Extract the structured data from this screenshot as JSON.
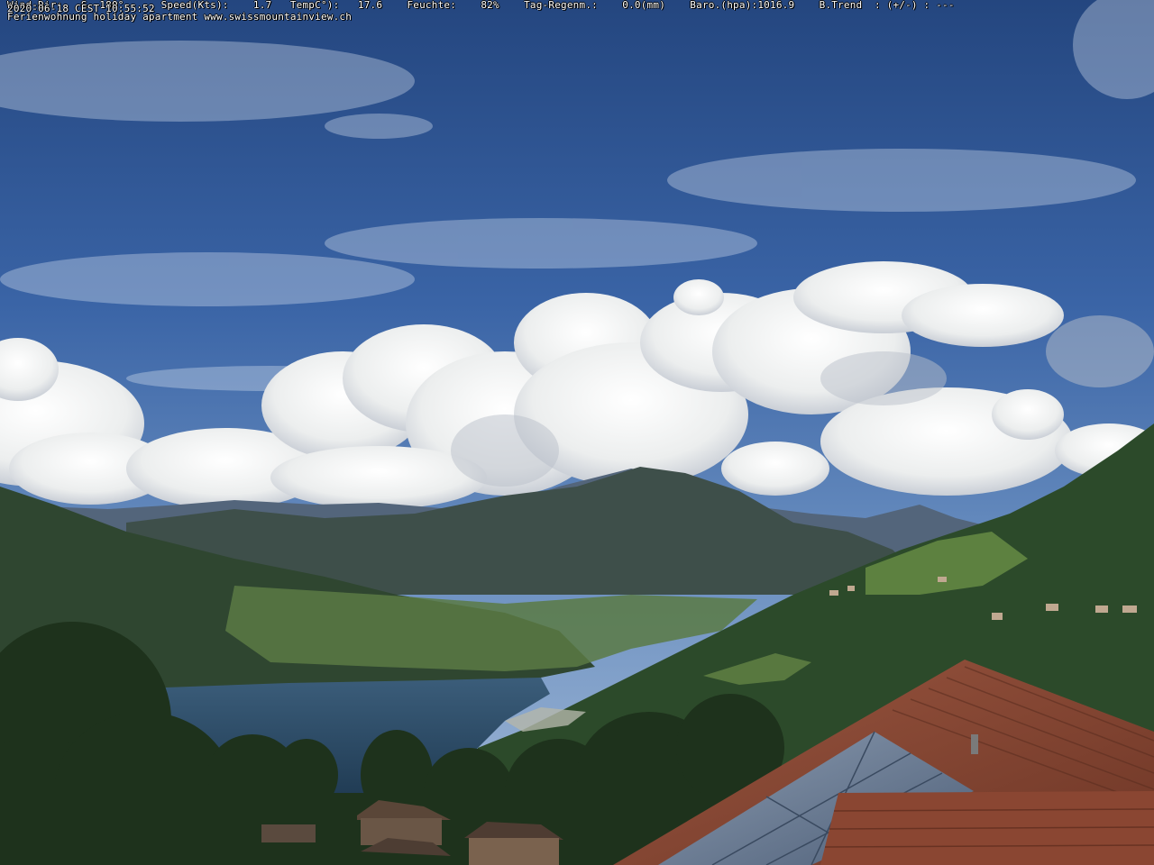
{
  "overlay": {
    "line1": "Wind-Dir:   S  180°      Speed(Kts):    1.7   TempC°):   17.6    Feuchte:    82%    Tag-Regenm.:    0.0(mm)    Baro.(hpa):1016.9    B.Trend  : (+/-) : ---",
    "line2": "Ferienwohnung holiday apartment www.swissmountainview.ch",
    "timestamp": "2020-06-18 CEST 10:55:52"
  },
  "scene": {
    "sky_color": "#2f5aa0",
    "cloud_color": "#f4f4f2",
    "lake_color": "#2c4a66",
    "roof_color": "#8a4a34",
    "solar_panel_color": "#6d7f96"
  }
}
